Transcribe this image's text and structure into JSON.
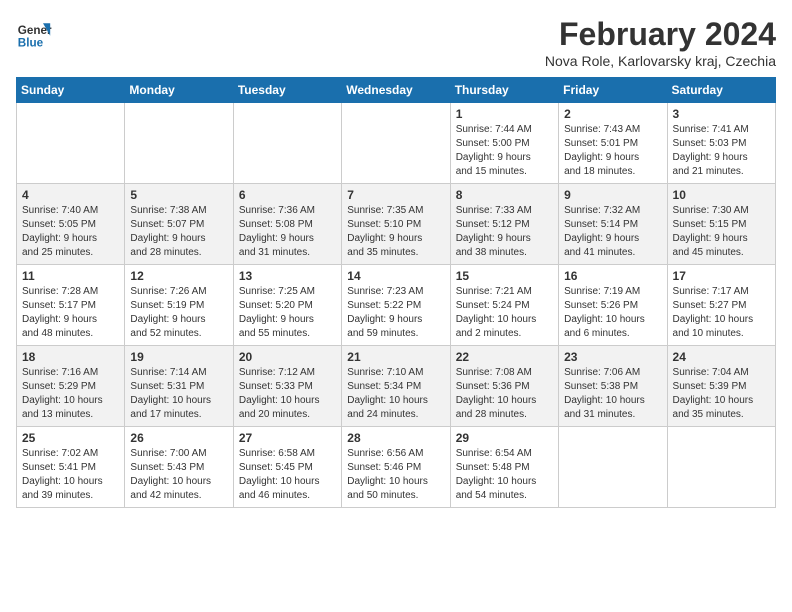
{
  "header": {
    "logo_line1": "General",
    "logo_line2": "Blue",
    "month_title": "February 2024",
    "subtitle": "Nova Role, Karlovarsky kraj, Czechia"
  },
  "weekdays": [
    "Sunday",
    "Monday",
    "Tuesday",
    "Wednesday",
    "Thursday",
    "Friday",
    "Saturday"
  ],
  "weeks": [
    [
      {
        "day": "",
        "info": ""
      },
      {
        "day": "",
        "info": ""
      },
      {
        "day": "",
        "info": ""
      },
      {
        "day": "",
        "info": ""
      },
      {
        "day": "1",
        "info": "Sunrise: 7:44 AM\nSunset: 5:00 PM\nDaylight: 9 hours\nand 15 minutes."
      },
      {
        "day": "2",
        "info": "Sunrise: 7:43 AM\nSunset: 5:01 PM\nDaylight: 9 hours\nand 18 minutes."
      },
      {
        "day": "3",
        "info": "Sunrise: 7:41 AM\nSunset: 5:03 PM\nDaylight: 9 hours\nand 21 minutes."
      }
    ],
    [
      {
        "day": "4",
        "info": "Sunrise: 7:40 AM\nSunset: 5:05 PM\nDaylight: 9 hours\nand 25 minutes."
      },
      {
        "day": "5",
        "info": "Sunrise: 7:38 AM\nSunset: 5:07 PM\nDaylight: 9 hours\nand 28 minutes."
      },
      {
        "day": "6",
        "info": "Sunrise: 7:36 AM\nSunset: 5:08 PM\nDaylight: 9 hours\nand 31 minutes."
      },
      {
        "day": "7",
        "info": "Sunrise: 7:35 AM\nSunset: 5:10 PM\nDaylight: 9 hours\nand 35 minutes."
      },
      {
        "day": "8",
        "info": "Sunrise: 7:33 AM\nSunset: 5:12 PM\nDaylight: 9 hours\nand 38 minutes."
      },
      {
        "day": "9",
        "info": "Sunrise: 7:32 AM\nSunset: 5:14 PM\nDaylight: 9 hours\nand 41 minutes."
      },
      {
        "day": "10",
        "info": "Sunrise: 7:30 AM\nSunset: 5:15 PM\nDaylight: 9 hours\nand 45 minutes."
      }
    ],
    [
      {
        "day": "11",
        "info": "Sunrise: 7:28 AM\nSunset: 5:17 PM\nDaylight: 9 hours\nand 48 minutes."
      },
      {
        "day": "12",
        "info": "Sunrise: 7:26 AM\nSunset: 5:19 PM\nDaylight: 9 hours\nand 52 minutes."
      },
      {
        "day": "13",
        "info": "Sunrise: 7:25 AM\nSunset: 5:20 PM\nDaylight: 9 hours\nand 55 minutes."
      },
      {
        "day": "14",
        "info": "Sunrise: 7:23 AM\nSunset: 5:22 PM\nDaylight: 9 hours\nand 59 minutes."
      },
      {
        "day": "15",
        "info": "Sunrise: 7:21 AM\nSunset: 5:24 PM\nDaylight: 10 hours\nand 2 minutes."
      },
      {
        "day": "16",
        "info": "Sunrise: 7:19 AM\nSunset: 5:26 PM\nDaylight: 10 hours\nand 6 minutes."
      },
      {
        "day": "17",
        "info": "Sunrise: 7:17 AM\nSunset: 5:27 PM\nDaylight: 10 hours\nand 10 minutes."
      }
    ],
    [
      {
        "day": "18",
        "info": "Sunrise: 7:16 AM\nSunset: 5:29 PM\nDaylight: 10 hours\nand 13 minutes."
      },
      {
        "day": "19",
        "info": "Sunrise: 7:14 AM\nSunset: 5:31 PM\nDaylight: 10 hours\nand 17 minutes."
      },
      {
        "day": "20",
        "info": "Sunrise: 7:12 AM\nSunset: 5:33 PM\nDaylight: 10 hours\nand 20 minutes."
      },
      {
        "day": "21",
        "info": "Sunrise: 7:10 AM\nSunset: 5:34 PM\nDaylight: 10 hours\nand 24 minutes."
      },
      {
        "day": "22",
        "info": "Sunrise: 7:08 AM\nSunset: 5:36 PM\nDaylight: 10 hours\nand 28 minutes."
      },
      {
        "day": "23",
        "info": "Sunrise: 7:06 AM\nSunset: 5:38 PM\nDaylight: 10 hours\nand 31 minutes."
      },
      {
        "day": "24",
        "info": "Sunrise: 7:04 AM\nSunset: 5:39 PM\nDaylight: 10 hours\nand 35 minutes."
      }
    ],
    [
      {
        "day": "25",
        "info": "Sunrise: 7:02 AM\nSunset: 5:41 PM\nDaylight: 10 hours\nand 39 minutes."
      },
      {
        "day": "26",
        "info": "Sunrise: 7:00 AM\nSunset: 5:43 PM\nDaylight: 10 hours\nand 42 minutes."
      },
      {
        "day": "27",
        "info": "Sunrise: 6:58 AM\nSunset: 5:45 PM\nDaylight: 10 hours\nand 46 minutes."
      },
      {
        "day": "28",
        "info": "Sunrise: 6:56 AM\nSunset: 5:46 PM\nDaylight: 10 hours\nand 50 minutes."
      },
      {
        "day": "29",
        "info": "Sunrise: 6:54 AM\nSunset: 5:48 PM\nDaylight: 10 hours\nand 54 minutes."
      },
      {
        "day": "",
        "info": ""
      },
      {
        "day": "",
        "info": ""
      }
    ]
  ]
}
